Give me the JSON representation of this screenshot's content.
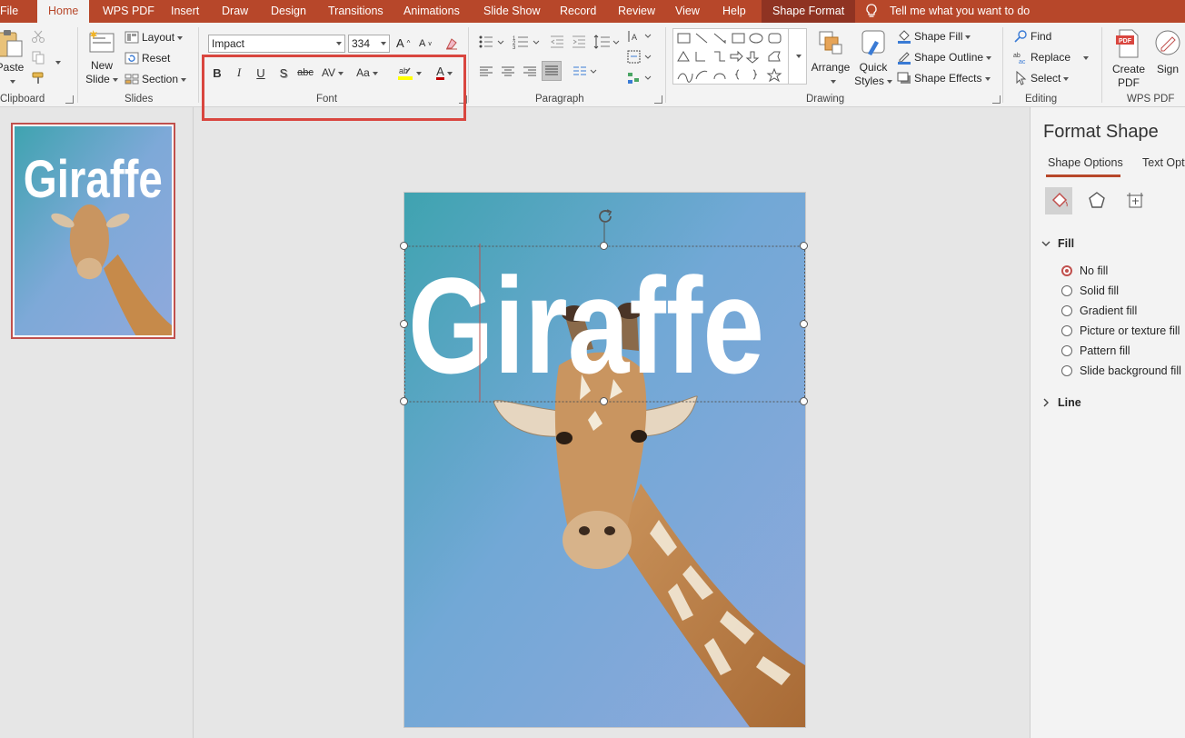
{
  "colors": {
    "accent": "#b7472a",
    "selection": "#c0504d",
    "sky_top": "#3fa3b0",
    "sky_bottom": "#8fa9dc"
  },
  "tabs": [
    "File",
    "Home",
    "WPS PDF",
    "Insert",
    "Draw",
    "Design",
    "Transitions",
    "Animations",
    "Slide Show",
    "Record",
    "Review",
    "View",
    "Help",
    "Shape Format"
  ],
  "active_tab": "Home",
  "tell_me": "Tell me what you want to do",
  "clipboard": {
    "paste": "Paste",
    "label": "Clipboard"
  },
  "slides_group": {
    "new_slide_line1": "New",
    "new_slide_line2": "Slide",
    "layout": "Layout",
    "reset": "Reset",
    "section": "Section",
    "label": "Slides"
  },
  "font": {
    "name": "Impact",
    "size": "334",
    "label": "Font",
    "bold": "B",
    "italic": "I",
    "underline": "U",
    "shadow": "S",
    "strike": "abc",
    "spacing": "AV",
    "case": "Aa",
    "grow": "A",
    "shrink": "A",
    "color": "A"
  },
  "paragraph": {
    "label": "Paragraph"
  },
  "drawing": {
    "arrange": "Arrange",
    "quick_styles_line1": "Quick",
    "quick_styles_line2": "Styles",
    "shape_fill": "Shape Fill",
    "shape_outline": "Shape Outline",
    "shape_effects": "Shape Effects",
    "label": "Drawing"
  },
  "editing": {
    "find": "Find",
    "replace": "Replace",
    "select": "Select",
    "label": "Editing"
  },
  "wps": {
    "create_pdf_line1": "Create",
    "create_pdf_line2": "PDF",
    "sign": "Sign",
    "label": "WPS PDF",
    "pdf_badge": "PDF"
  },
  "thumbnail": {
    "title": "Giraffe"
  },
  "slide": {
    "title": "Giraffe"
  },
  "format_panel": {
    "title": "Format Shape",
    "tab_shape": "Shape Options",
    "tab_text": "Text Opti",
    "fill_section": "Fill",
    "line_section": "Line",
    "fill_options": [
      "No fill",
      "Solid fill",
      "Gradient fill",
      "Picture or texture fill",
      "Pattern fill",
      "Slide background fill"
    ],
    "selected_fill": "No fill"
  }
}
